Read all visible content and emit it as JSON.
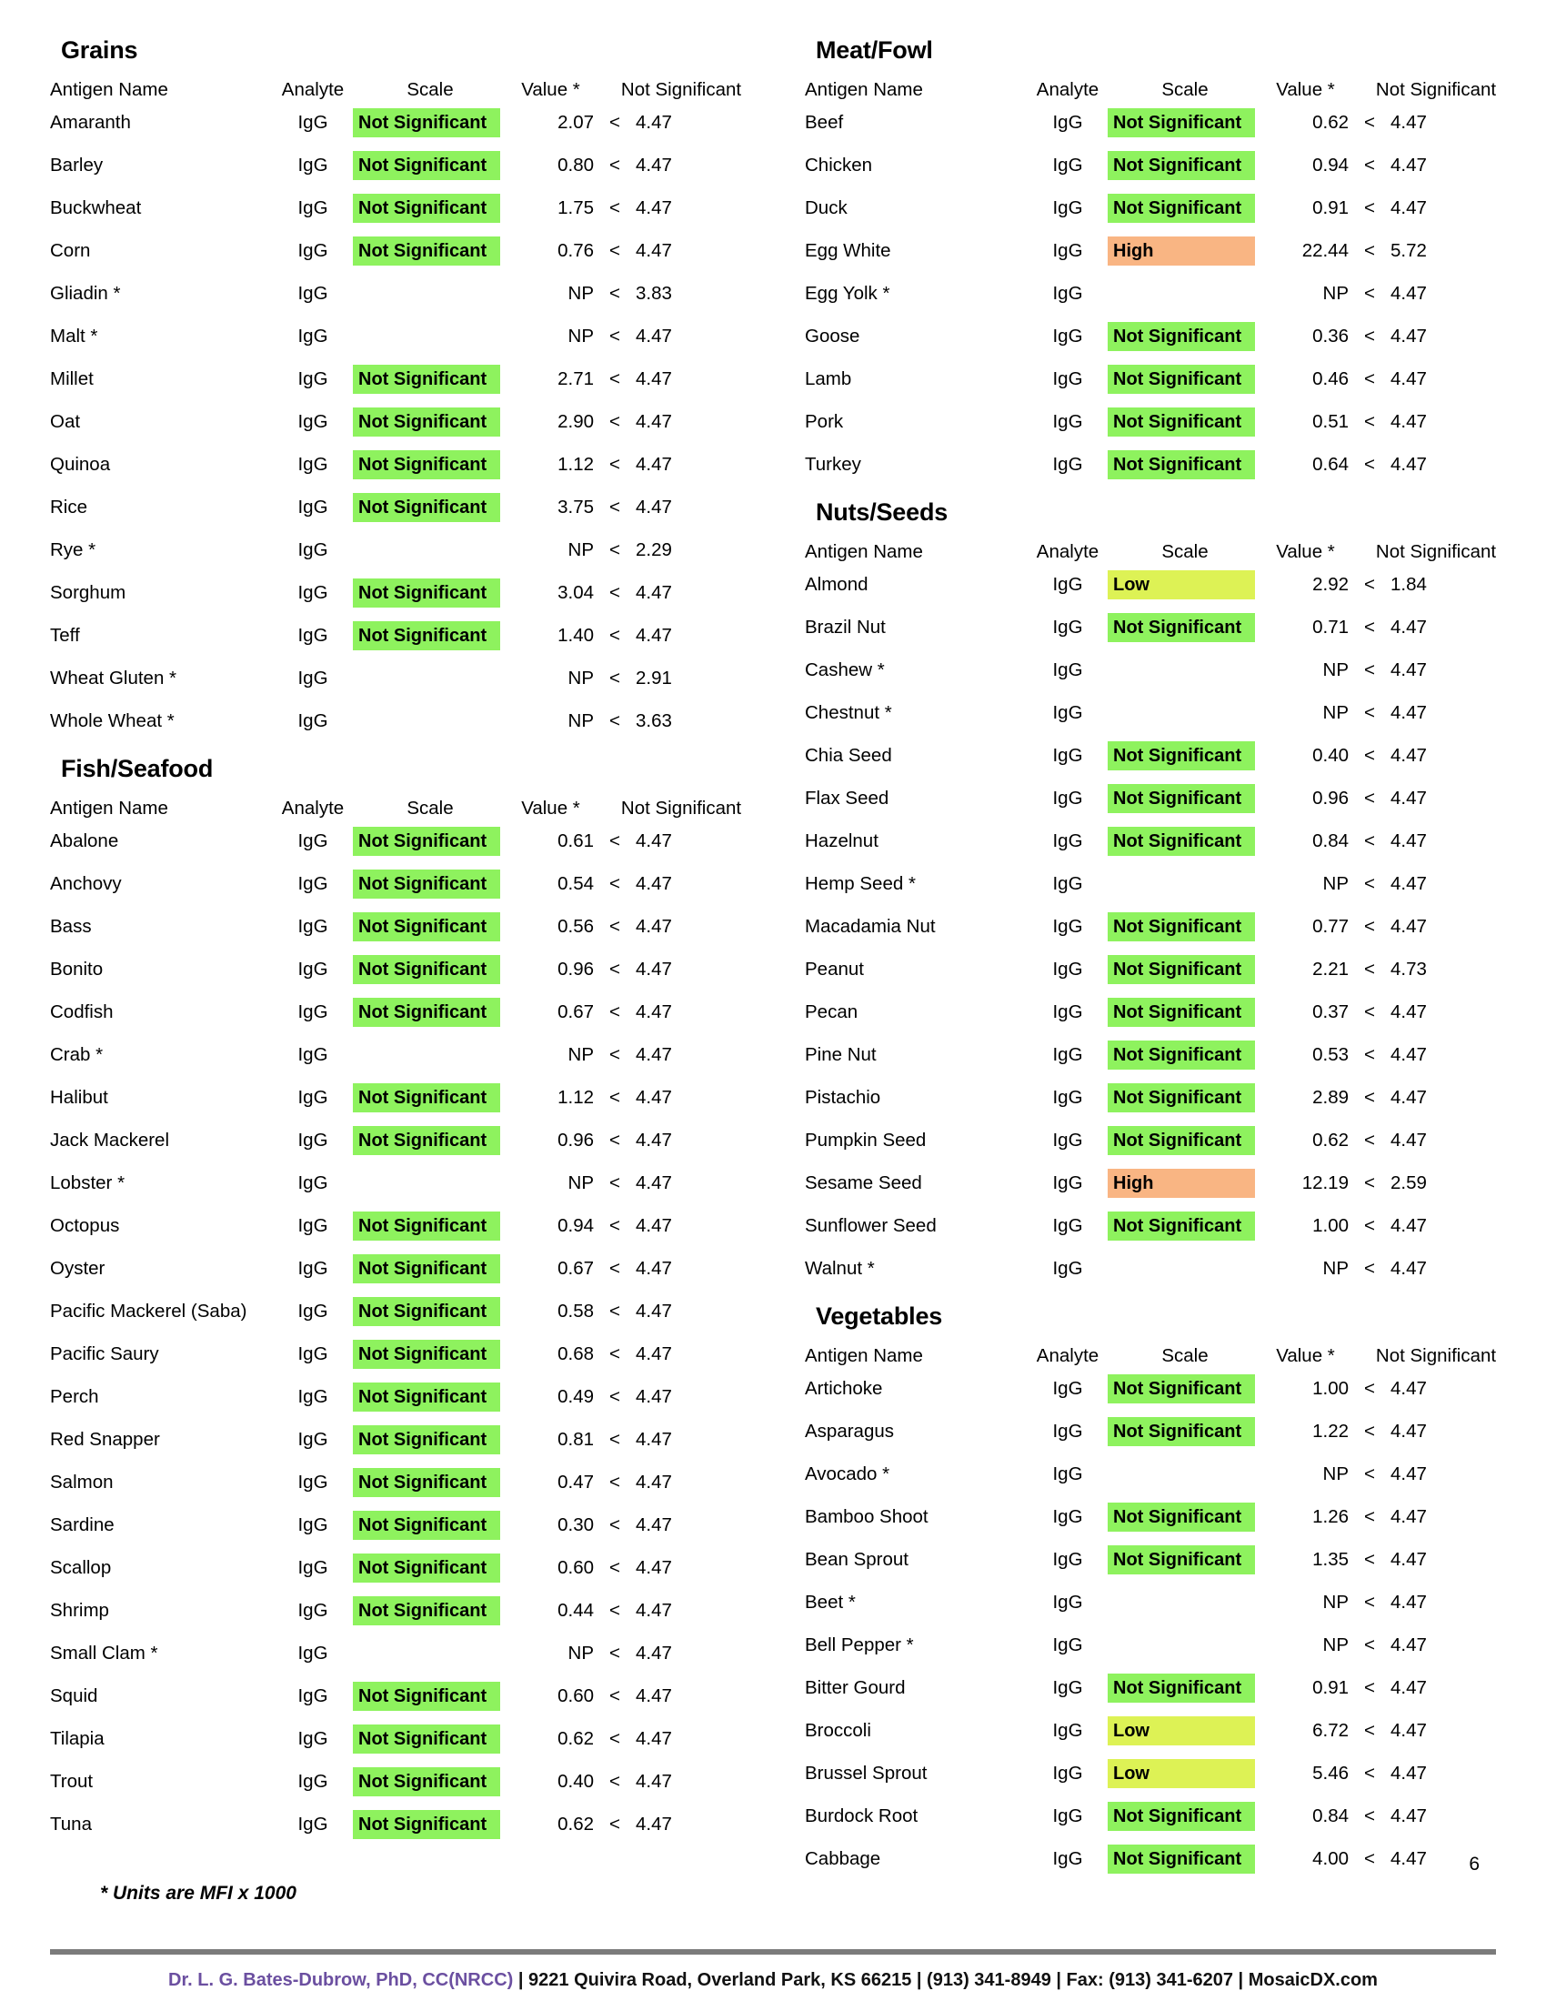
{
  "footer": {
    "footnote": "* Units are MFI x 1000",
    "page_number": "6",
    "doctor": "Dr. L. G. Bates-Dubrow, PhD, CC(NRCC)",
    "contact": " | 9221 Quivira Road, Overland Park, KS 66215  |  (913) 341-8949  |  Fax: (913) 341-6207 | MosaicDX.com",
    "doctor_color": "#6b4fa0"
  },
  "scale_colors": {
    "not_significant": "#8ef25e",
    "low": "#ddf255",
    "high": "#f9b583"
  },
  "columns": {
    "name": "Antigen Name",
    "analyte": "Analyte",
    "scale": "Scale",
    "value": "Value *",
    "reference": "Not Significant",
    "lt_symbol": "<"
  },
  "left_column": [
    {
      "title": "Grains",
      "rows": [
        {
          "name": "Amaranth",
          "analyte": "IgG",
          "scale": "Not Significant",
          "scale_class": "ns",
          "value": "2.07",
          "lt": "<",
          "ref": "4.47"
        },
        {
          "name": "Barley",
          "analyte": "IgG",
          "scale": "Not Significant",
          "scale_class": "ns",
          "value": "0.80",
          "lt": "<",
          "ref": "4.47"
        },
        {
          "name": "Buckwheat",
          "analyte": "IgG",
          "scale": "Not Significant",
          "scale_class": "ns",
          "value": "1.75",
          "lt": "<",
          "ref": "4.47"
        },
        {
          "name": "Corn",
          "analyte": "IgG",
          "scale": "Not Significant",
          "scale_class": "ns",
          "value": "0.76",
          "lt": "<",
          "ref": "4.47"
        },
        {
          "name": "Gliadin *",
          "analyte": "IgG",
          "scale": "",
          "scale_class": "none",
          "value": "NP",
          "lt": "<",
          "ref": "3.83"
        },
        {
          "name": "Malt *",
          "analyte": "IgG",
          "scale": "",
          "scale_class": "none",
          "value": "NP",
          "lt": "<",
          "ref": "4.47"
        },
        {
          "name": "Millet",
          "analyte": "IgG",
          "scale": "Not Significant",
          "scale_class": "ns",
          "value": "2.71",
          "lt": "<",
          "ref": "4.47"
        },
        {
          "name": "Oat",
          "analyte": "IgG",
          "scale": "Not Significant",
          "scale_class": "ns",
          "value": "2.90",
          "lt": "<",
          "ref": "4.47"
        },
        {
          "name": "Quinoa",
          "analyte": "IgG",
          "scale": "Not Significant",
          "scale_class": "ns",
          "value": "1.12",
          "lt": "<",
          "ref": "4.47"
        },
        {
          "name": "Rice",
          "analyte": "IgG",
          "scale": "Not Significant",
          "scale_class": "ns",
          "value": "3.75",
          "lt": "<",
          "ref": "4.47"
        },
        {
          "name": "Rye *",
          "analyte": "IgG",
          "scale": "",
          "scale_class": "none",
          "value": "NP",
          "lt": "<",
          "ref": "2.29"
        },
        {
          "name": "Sorghum",
          "analyte": "IgG",
          "scale": "Not Significant",
          "scale_class": "ns",
          "value": "3.04",
          "lt": "<",
          "ref": "4.47"
        },
        {
          "name": "Teff",
          "analyte": "IgG",
          "scale": "Not Significant",
          "scale_class": "ns",
          "value": "1.40",
          "lt": "<",
          "ref": "4.47"
        },
        {
          "name": "Wheat Gluten *",
          "analyte": "IgG",
          "scale": "",
          "scale_class": "none",
          "value": "NP",
          "lt": "<",
          "ref": "2.91"
        },
        {
          "name": "Whole Wheat *",
          "analyte": "IgG",
          "scale": "",
          "scale_class": "none",
          "value": "NP",
          "lt": "<",
          "ref": "3.63"
        }
      ]
    },
    {
      "title": "Fish/Seafood",
      "rows": [
        {
          "name": "Abalone",
          "analyte": "IgG",
          "scale": "Not Significant",
          "scale_class": "ns",
          "value": "0.61",
          "lt": "<",
          "ref": "4.47"
        },
        {
          "name": "Anchovy",
          "analyte": "IgG",
          "scale": "Not Significant",
          "scale_class": "ns",
          "value": "0.54",
          "lt": "<",
          "ref": "4.47"
        },
        {
          "name": "Bass",
          "analyte": "IgG",
          "scale": "Not Significant",
          "scale_class": "ns",
          "value": "0.56",
          "lt": "<",
          "ref": "4.47"
        },
        {
          "name": "Bonito",
          "analyte": "IgG",
          "scale": "Not Significant",
          "scale_class": "ns",
          "value": "0.96",
          "lt": "<",
          "ref": "4.47"
        },
        {
          "name": "Codfish",
          "analyte": "IgG",
          "scale": "Not Significant",
          "scale_class": "ns",
          "value": "0.67",
          "lt": "<",
          "ref": "4.47"
        },
        {
          "name": "Crab *",
          "analyte": "IgG",
          "scale": "",
          "scale_class": "none",
          "value": "NP",
          "lt": "<",
          "ref": "4.47"
        },
        {
          "name": "Halibut",
          "analyte": "IgG",
          "scale": "Not Significant",
          "scale_class": "ns",
          "value": "1.12",
          "lt": "<",
          "ref": "4.47"
        },
        {
          "name": "Jack Mackerel",
          "analyte": "IgG",
          "scale": "Not Significant",
          "scale_class": "ns",
          "value": "0.96",
          "lt": "<",
          "ref": "4.47"
        },
        {
          "name": "Lobster *",
          "analyte": "IgG",
          "scale": "",
          "scale_class": "none",
          "value": "NP",
          "lt": "<",
          "ref": "4.47"
        },
        {
          "name": "Octopus",
          "analyte": "IgG",
          "scale": "Not Significant",
          "scale_class": "ns",
          "value": "0.94",
          "lt": "<",
          "ref": "4.47"
        },
        {
          "name": "Oyster",
          "analyte": "IgG",
          "scale": "Not Significant",
          "scale_class": "ns",
          "value": "0.67",
          "lt": "<",
          "ref": "4.47"
        },
        {
          "name": "Pacific Mackerel (Saba)",
          "analyte": "IgG",
          "scale": "Not Significant",
          "scale_class": "ns",
          "value": "0.58",
          "lt": "<",
          "ref": "4.47"
        },
        {
          "name": "Pacific Saury",
          "analyte": "IgG",
          "scale": "Not Significant",
          "scale_class": "ns",
          "value": "0.68",
          "lt": "<",
          "ref": "4.47"
        },
        {
          "name": "Perch",
          "analyte": "IgG",
          "scale": "Not Significant",
          "scale_class": "ns",
          "value": "0.49",
          "lt": "<",
          "ref": "4.47"
        },
        {
          "name": "Red Snapper",
          "analyte": "IgG",
          "scale": "Not Significant",
          "scale_class": "ns",
          "value": "0.81",
          "lt": "<",
          "ref": "4.47"
        },
        {
          "name": "Salmon",
          "analyte": "IgG",
          "scale": "Not Significant",
          "scale_class": "ns",
          "value": "0.47",
          "lt": "<",
          "ref": "4.47"
        },
        {
          "name": "Sardine",
          "analyte": "IgG",
          "scale": "Not Significant",
          "scale_class": "ns",
          "value": "0.30",
          "lt": "<",
          "ref": "4.47"
        },
        {
          "name": "Scallop",
          "analyte": "IgG",
          "scale": "Not Significant",
          "scale_class": "ns",
          "value": "0.60",
          "lt": "<",
          "ref": "4.47"
        },
        {
          "name": "Shrimp",
          "analyte": "IgG",
          "scale": "Not Significant",
          "scale_class": "ns",
          "value": "0.44",
          "lt": "<",
          "ref": "4.47"
        },
        {
          "name": "Small Clam *",
          "analyte": "IgG",
          "scale": "",
          "scale_class": "none",
          "value": "NP",
          "lt": "<",
          "ref": "4.47"
        },
        {
          "name": "Squid",
          "analyte": "IgG",
          "scale": "Not Significant",
          "scale_class": "ns",
          "value": "0.60",
          "lt": "<",
          "ref": "4.47"
        },
        {
          "name": "Tilapia",
          "analyte": "IgG",
          "scale": "Not Significant",
          "scale_class": "ns",
          "value": "0.62",
          "lt": "<",
          "ref": "4.47"
        },
        {
          "name": "Trout",
          "analyte": "IgG",
          "scale": "Not Significant",
          "scale_class": "ns",
          "value": "0.40",
          "lt": "<",
          "ref": "4.47"
        },
        {
          "name": "Tuna",
          "analyte": "IgG",
          "scale": "Not Significant",
          "scale_class": "ns",
          "value": "0.62",
          "lt": "<",
          "ref": "4.47"
        }
      ]
    }
  ],
  "right_column": [
    {
      "title": "Meat/Fowl",
      "rows": [
        {
          "name": "Beef",
          "analyte": "IgG",
          "scale": "Not Significant",
          "scale_class": "ns",
          "value": "0.62",
          "lt": "<",
          "ref": "4.47"
        },
        {
          "name": "Chicken",
          "analyte": "IgG",
          "scale": "Not Significant",
          "scale_class": "ns",
          "value": "0.94",
          "lt": "<",
          "ref": "4.47"
        },
        {
          "name": "Duck",
          "analyte": "IgG",
          "scale": "Not Significant",
          "scale_class": "ns",
          "value": "0.91",
          "lt": "<",
          "ref": "4.47"
        },
        {
          "name": "Egg White",
          "analyte": "IgG",
          "scale": "High",
          "scale_class": "high",
          "value": "22.44",
          "lt": "<",
          "ref": "5.72"
        },
        {
          "name": "Egg Yolk *",
          "analyte": "IgG",
          "scale": "",
          "scale_class": "none",
          "value": "NP",
          "lt": "<",
          "ref": "4.47"
        },
        {
          "name": "Goose",
          "analyte": "IgG",
          "scale": "Not Significant",
          "scale_class": "ns",
          "value": "0.36",
          "lt": "<",
          "ref": "4.47"
        },
        {
          "name": "Lamb",
          "analyte": "IgG",
          "scale": "Not Significant",
          "scale_class": "ns",
          "value": "0.46",
          "lt": "<",
          "ref": "4.47"
        },
        {
          "name": "Pork",
          "analyte": "IgG",
          "scale": "Not Significant",
          "scale_class": "ns",
          "value": "0.51",
          "lt": "<",
          "ref": "4.47"
        },
        {
          "name": "Turkey",
          "analyte": "IgG",
          "scale": "Not Significant",
          "scale_class": "ns",
          "value": "0.64",
          "lt": "<",
          "ref": "4.47"
        }
      ]
    },
    {
      "title": "Nuts/Seeds",
      "rows": [
        {
          "name": "Almond",
          "analyte": "IgG",
          "scale": "Low",
          "scale_class": "low",
          "value": "2.92",
          "lt": "<",
          "ref": "1.84"
        },
        {
          "name": "Brazil Nut",
          "analyte": "IgG",
          "scale": "Not Significant",
          "scale_class": "ns",
          "value": "0.71",
          "lt": "<",
          "ref": "4.47"
        },
        {
          "name": "Cashew *",
          "analyte": "IgG",
          "scale": "",
          "scale_class": "none",
          "value": "NP",
          "lt": "<",
          "ref": "4.47"
        },
        {
          "name": "Chestnut *",
          "analyte": "IgG",
          "scale": "",
          "scale_class": "none",
          "value": "NP",
          "lt": "<",
          "ref": "4.47"
        },
        {
          "name": "Chia Seed",
          "analyte": "IgG",
          "scale": "Not Significant",
          "scale_class": "ns",
          "value": "0.40",
          "lt": "<",
          "ref": "4.47"
        },
        {
          "name": "Flax Seed",
          "analyte": "IgG",
          "scale": "Not Significant",
          "scale_class": "ns",
          "value": "0.96",
          "lt": "<",
          "ref": "4.47"
        },
        {
          "name": "Hazelnut",
          "analyte": "IgG",
          "scale": "Not Significant",
          "scale_class": "ns",
          "value": "0.84",
          "lt": "<",
          "ref": "4.47"
        },
        {
          "name": "Hemp Seed *",
          "analyte": "IgG",
          "scale": "",
          "scale_class": "none",
          "value": "NP",
          "lt": "<",
          "ref": "4.47"
        },
        {
          "name": "Macadamia Nut",
          "analyte": "IgG",
          "scale": "Not Significant",
          "scale_class": "ns",
          "value": "0.77",
          "lt": "<",
          "ref": "4.47"
        },
        {
          "name": "Peanut",
          "analyte": "IgG",
          "scale": "Not Significant",
          "scale_class": "ns",
          "value": "2.21",
          "lt": "<",
          "ref": "4.73"
        },
        {
          "name": "Pecan",
          "analyte": "IgG",
          "scale": "Not Significant",
          "scale_class": "ns",
          "value": "0.37",
          "lt": "<",
          "ref": "4.47"
        },
        {
          "name": "Pine Nut",
          "analyte": "IgG",
          "scale": "Not Significant",
          "scale_class": "ns",
          "value": "0.53",
          "lt": "<",
          "ref": "4.47"
        },
        {
          "name": "Pistachio",
          "analyte": "IgG",
          "scale": "Not Significant",
          "scale_class": "ns",
          "value": "2.89",
          "lt": "<",
          "ref": "4.47"
        },
        {
          "name": "Pumpkin Seed",
          "analyte": "IgG",
          "scale": "Not Significant",
          "scale_class": "ns",
          "value": "0.62",
          "lt": "<",
          "ref": "4.47"
        },
        {
          "name": "Sesame Seed",
          "analyte": "IgG",
          "scale": "High",
          "scale_class": "high",
          "value": "12.19",
          "lt": "<",
          "ref": "2.59"
        },
        {
          "name": "Sunflower Seed",
          "analyte": "IgG",
          "scale": "Not Significant",
          "scale_class": "ns",
          "value": "1.00",
          "lt": "<",
          "ref": "4.47"
        },
        {
          "name": "Walnut *",
          "analyte": "IgG",
          "scale": "",
          "scale_class": "none",
          "value": "NP",
          "lt": "<",
          "ref": "4.47"
        }
      ]
    },
    {
      "title": "Vegetables",
      "rows": [
        {
          "name": "Artichoke",
          "analyte": "IgG",
          "scale": "Not Significant",
          "scale_class": "ns",
          "value": "1.00",
          "lt": "<",
          "ref": "4.47"
        },
        {
          "name": "Asparagus",
          "analyte": "IgG",
          "scale": "Not Significant",
          "scale_class": "ns",
          "value": "1.22",
          "lt": "<",
          "ref": "4.47"
        },
        {
          "name": "Avocado *",
          "analyte": "IgG",
          "scale": "",
          "scale_class": "none",
          "value": "NP",
          "lt": "<",
          "ref": "4.47"
        },
        {
          "name": "Bamboo Shoot",
          "analyte": "IgG",
          "scale": "Not Significant",
          "scale_class": "ns",
          "value": "1.26",
          "lt": "<",
          "ref": "4.47"
        },
        {
          "name": "Bean Sprout",
          "analyte": "IgG",
          "scale": "Not Significant",
          "scale_class": "ns",
          "value": "1.35",
          "lt": "<",
          "ref": "4.47"
        },
        {
          "name": "Beet *",
          "analyte": "IgG",
          "scale": "",
          "scale_class": "none",
          "value": "NP",
          "lt": "<",
          "ref": "4.47"
        },
        {
          "name": "Bell Pepper *",
          "analyte": "IgG",
          "scale": "",
          "scale_class": "none",
          "value": "NP",
          "lt": "<",
          "ref": "4.47"
        },
        {
          "name": "Bitter Gourd",
          "analyte": "IgG",
          "scale": "Not Significant",
          "scale_class": "ns",
          "value": "0.91",
          "lt": "<",
          "ref": "4.47"
        },
        {
          "name": "Broccoli",
          "analyte": "IgG",
          "scale": "Low",
          "scale_class": "low",
          "value": "6.72",
          "lt": "<",
          "ref": "4.47"
        },
        {
          "name": "Brussel Sprout",
          "analyte": "IgG",
          "scale": "Low",
          "scale_class": "low",
          "value": "5.46",
          "lt": "<",
          "ref": "4.47"
        },
        {
          "name": "Burdock Root",
          "analyte": "IgG",
          "scale": "Not Significant",
          "scale_class": "ns",
          "value": "0.84",
          "lt": "<",
          "ref": "4.47"
        },
        {
          "name": "Cabbage",
          "analyte": "IgG",
          "scale": "Not Significant",
          "scale_class": "ns",
          "value": "4.00",
          "lt": "<",
          "ref": "4.47"
        }
      ]
    }
  ]
}
